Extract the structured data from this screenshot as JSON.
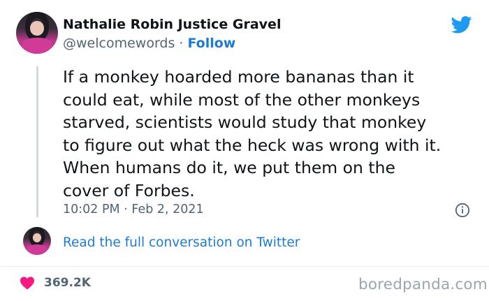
{
  "author": {
    "name": "Nathalie Robin Justice Gravel",
    "handle": "@welcomewords",
    "separator": "·",
    "follow_label": "Follow"
  },
  "tweet": {
    "text": "If a monkey hoarded more bananas than it\ncould eat, while most of the other monkeys\nstarved, scientists would study that monkey\nto figure out what the heck was wrong with it.\nWhen humans do it, we put them on the\ncover of Forbes.",
    "timestamp": "10:02 PM · Feb 2, 2021"
  },
  "conversation_link": "Read the full conversation on Twitter",
  "likes": "369.2K",
  "watermark": "boredpanda.com",
  "colors": {
    "twitter_blue": "#1d9bf0",
    "link_blue": "#1d7bd3",
    "heart_red": "#f91880",
    "muted_text": "#536471"
  },
  "icons": [
    "twitter-bird-icon",
    "info-icon",
    "heart-icon"
  ]
}
